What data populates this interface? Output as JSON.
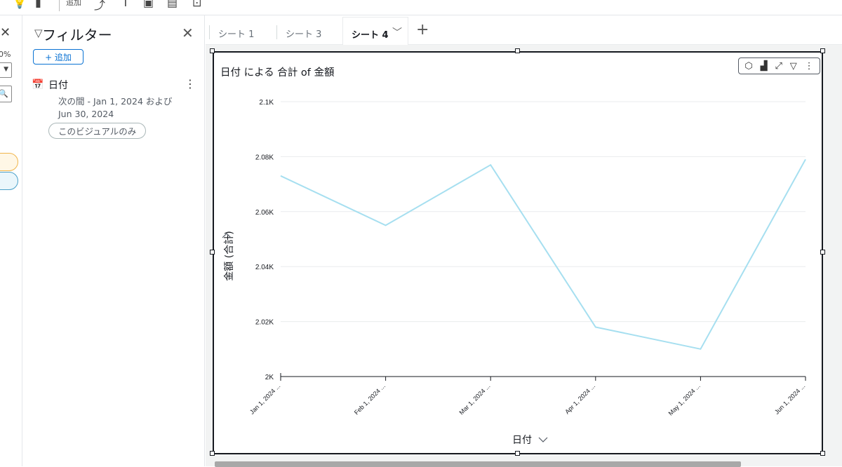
{
  "toolbar": {
    "add_label": "追加"
  },
  "left_panel": {
    "zoom_pct": "0%"
  },
  "filters": {
    "title": "フィルター",
    "add_button": "+ 追加",
    "items": [
      {
        "name": "日付",
        "desc_line1": "次の間 - Jan 1, 2024 および",
        "desc_line2": "Jun 30, 2024",
        "scope": "このビジュアルのみ"
      }
    ]
  },
  "sheets": {
    "tabs": [
      "シート 1",
      "シート 3"
    ],
    "active": "シート 4"
  },
  "visual": {
    "title": "日付 による 合計 of 金額"
  },
  "chart_data": {
    "type": "line",
    "title": "日付 による 合計 of 金額",
    "xlabel": "日付",
    "ylabel": "金額 (合計)",
    "categories": [
      "Jan 1, 2024 ...",
      "Feb 1, 2024 ...",
      "Mar 1, 2024 ...",
      "Apr 1, 2024 ...",
      "May 1, 2024 ...",
      "Jun 1, 2024 ..."
    ],
    "series": [
      {
        "values": [
          2073,
          2055,
          2077,
          2018,
          2010,
          2079
        ],
        "color": "#a6dff0"
      }
    ],
    "ylim": [
      2000,
      2100
    ],
    "yticks": [
      2000,
      2020,
      2040,
      2060,
      2080,
      2100
    ],
    "ytick_labels": [
      "2K",
      "2.02K",
      "2.04K",
      "2.06K",
      "2.08K",
      "2.1K"
    ],
    "grid": true
  }
}
